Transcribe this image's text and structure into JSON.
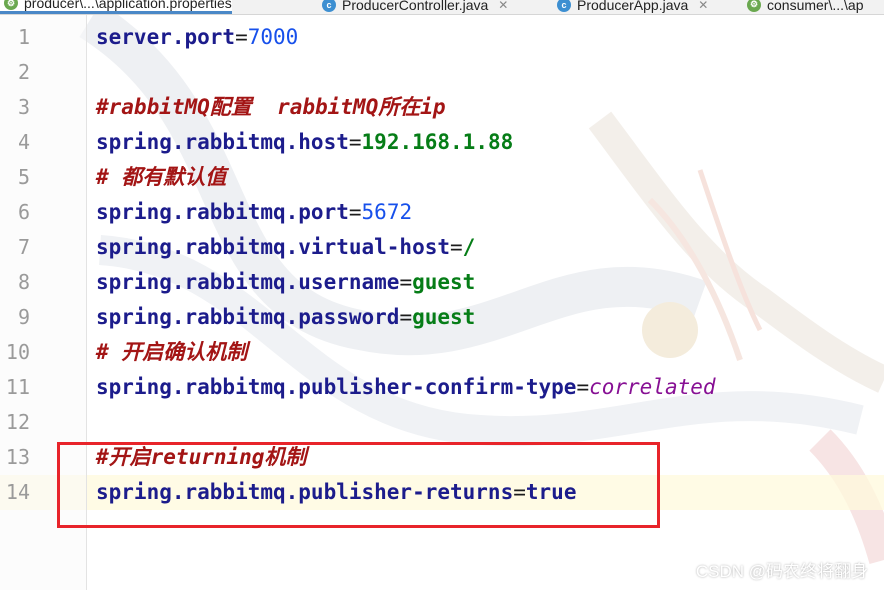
{
  "tabs": [
    {
      "label": "producer\\...\\application.properties",
      "icon": "properties-file-icon",
      "active": true
    },
    {
      "label": "ProducerController.java",
      "icon": "java-class-icon",
      "active": false
    },
    {
      "label": "ProducerApp.java",
      "icon": "java-class-icon",
      "active": false
    },
    {
      "label": "consumer\\...\\ap",
      "icon": "properties-file-icon",
      "active": false
    }
  ],
  "line_numbers": [
    "1",
    "2",
    "3",
    "4",
    "5",
    "6",
    "7",
    "8",
    "9",
    "10",
    "11",
    "12",
    "13",
    "14"
  ],
  "code": {
    "l1": {
      "key": "server.port",
      "eq": "=",
      "val": "7000"
    },
    "l3": {
      "comment": "#rabbitMQ配置  rabbitMQ所在ip"
    },
    "l4": {
      "key": "spring.rabbitmq.host",
      "eq": "=",
      "val": "192.168.1.88"
    },
    "l5": {
      "comment": "# 都有默认值"
    },
    "l6": {
      "key": "spring.rabbitmq.port",
      "eq": "=",
      "val": "5672"
    },
    "l7": {
      "key": "spring.rabbitmq.virtual-host",
      "eq": "=",
      "val": "/"
    },
    "l8": {
      "key": "spring.rabbitmq.username",
      "eq": "=",
      "val": "guest"
    },
    "l9": {
      "key": "spring.rabbitmq.password",
      "eq": "=",
      "val": "guest"
    },
    "l10": {
      "comment": "# 开启确认机制"
    },
    "l11": {
      "key": "spring.rabbitmq.publisher-confirm-type",
      "eq": "=",
      "val": "correlated"
    },
    "l13": {
      "comment": "#开启returning机制"
    },
    "l14": {
      "key": "spring.rabbitmq.publisher-returns",
      "eq": "=",
      "val": "true"
    }
  },
  "watermark": "CSDN @码农终将翻身",
  "colors": {
    "highlight_box": "#e8242a",
    "active_tab_underline": "#4a88c7"
  }
}
